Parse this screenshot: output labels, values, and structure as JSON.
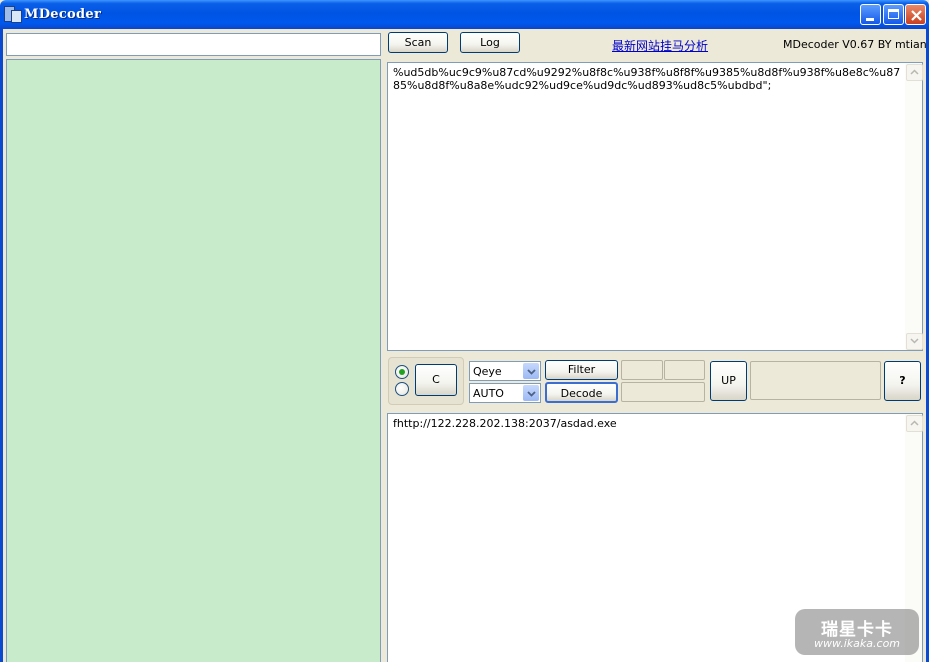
{
  "window": {
    "title": "MDecoder",
    "controls": {
      "minimize": "minimize-icon",
      "maximize": "maximize-icon",
      "close": "close-icon"
    }
  },
  "toolbar": {
    "url_input_value": "",
    "scan_label": "Scan",
    "log_label": "Log",
    "site_link": "最新网站挂马分析",
    "version": "MDecoder V0.67   BY mtian"
  },
  "input_area": {
    "text": "%ud5db%uc9c9%u87cd%u9292%u8f8c%u938f%u8f8f%u9385%u8d8f%u938f%u8e8c%u8785%u8d8f%u8a8e%udc92%ud9ce%ud9dc%ud893%ud8c5%ubdbd\";"
  },
  "controls": {
    "radio_options": [
      {
        "checked": true
      },
      {
        "checked": false
      }
    ],
    "c_button_label": "C",
    "engine_select": {
      "selected": "Qeye"
    },
    "mode_select": {
      "selected": "AUTO"
    },
    "filter_label": "Filter",
    "decode_label": "Decode",
    "up_label": "UP",
    "help_label": "?"
  },
  "output_area": {
    "text": "fhttp://122.228.202.138:2037/asdad.exe"
  },
  "watermark": {
    "text_cn": "瑞星卡卡",
    "url": "www.ikaka.com"
  },
  "colors": {
    "titlebar": "#0054e3",
    "file_list_bg": "#c7ebcb",
    "window_bg": "#ece9d8",
    "link": "#0000cc"
  }
}
